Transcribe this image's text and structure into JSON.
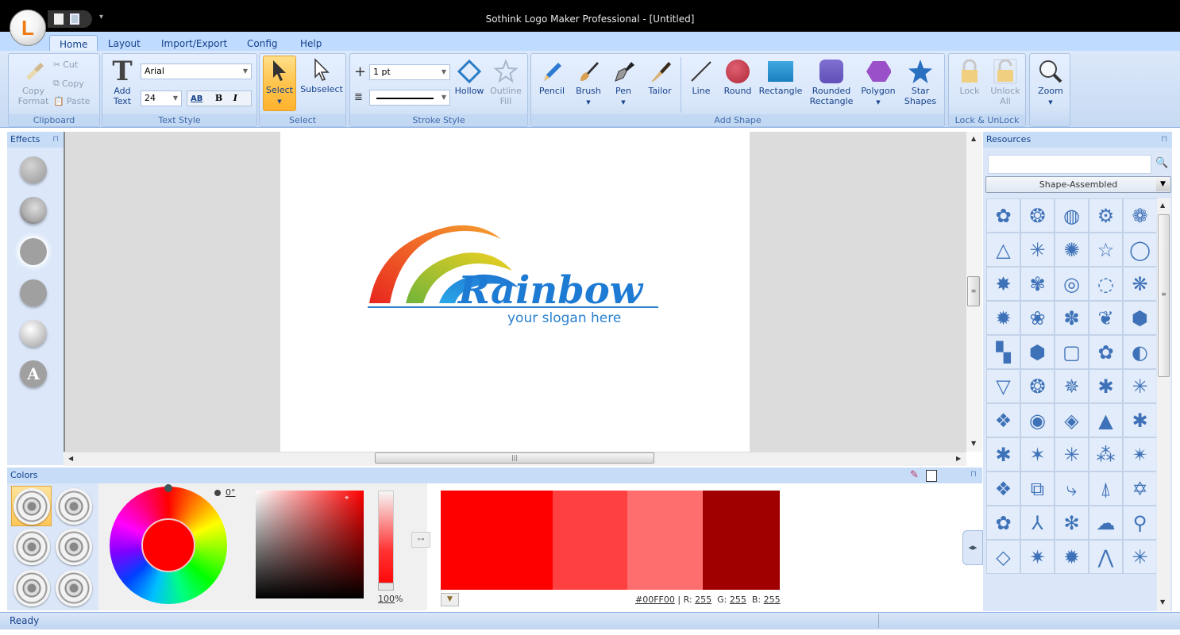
{
  "window": {
    "title": "Sothink Logo Maker Professional - [Untitled]",
    "orb_letter": "L"
  },
  "tabs": [
    {
      "label": "Home",
      "active": true
    },
    {
      "label": "Layout"
    },
    {
      "label": "Import/Export"
    },
    {
      "label": "Config"
    },
    {
      "label": "Help"
    }
  ],
  "ribbon": {
    "clipboard": {
      "label": "Clipboard",
      "copy_format": "Copy Format",
      "cut": "Cut",
      "copy": "Copy",
      "paste": "Paste"
    },
    "text_style": {
      "label": "Text Style",
      "add_text": "Add Text",
      "font": "Arial",
      "size": "24",
      "bold": "B",
      "italic": "I",
      "spacing": "AB"
    },
    "select": {
      "label": "Select",
      "select": "Select",
      "subselect": "Subselect"
    },
    "stroke_style": {
      "label": "Stroke Style",
      "width": "1 pt",
      "hollow": "Hollow",
      "outline_fill": "Outline Fill"
    },
    "draw": {
      "pencil": "Pencil",
      "brush": "Brush",
      "pen": "Pen",
      "tailor": "Tailor"
    },
    "add_shape": {
      "label": "Add Shape",
      "line": "Line",
      "round": "Round",
      "rectangle": "Rectangle",
      "rounded_rectangle": "Rounded Rectangle",
      "polygon": "Polygon",
      "star_shapes": "Star Shapes"
    },
    "lock": {
      "label": "Lock & UnLock",
      "lock": "Lock",
      "unlock_all": "Unlock All"
    },
    "zoom": {
      "label": "Zoom"
    }
  },
  "effects": {
    "title": "Effects",
    "items": [
      "shadow",
      "bevel",
      "glow",
      "reflection",
      "gradient",
      "text"
    ],
    "text_glyph": "A"
  },
  "canvas": {
    "logo_title": "Rainbow",
    "logo_slogan": "your slogan here",
    "colors": {
      "arc1": "#e8321e",
      "arc2": "#8cc63e",
      "arc3": "#2a9de3",
      "text": "#1e7bd4"
    }
  },
  "resources": {
    "title": "Resources",
    "search_placeholder": "",
    "category": "Shape-Assembled",
    "shapes": [
      "✿",
      "❂",
      "◍",
      "⚙",
      "❁",
      "△",
      "✳",
      "✺",
      "☆",
      "◯",
      "✸",
      "✾",
      "◎",
      "◌",
      "❋",
      "✹",
      "❀",
      "✽",
      "❦",
      "⬢",
      "▚",
      "⬢",
      "▢",
      "✿",
      "◐",
      "▽",
      "❂",
      "✵",
      "✱",
      "✳",
      "❖",
      "◉",
      "◈",
      "▲",
      "✱",
      "✱",
      "✶",
      "✳",
      "⁂",
      "✴",
      "❖",
      "⧉",
      "⤷",
      "⍋",
      "✡",
      "✿",
      "⅄",
      "✻",
      "☁",
      "⚲",
      "◇",
      "✷",
      "✹",
      "⋀",
      "✳"
    ]
  },
  "colors": {
    "title": "Colors",
    "angle": "0°",
    "alpha": "100",
    "alpha_unit": "%",
    "swatches": [
      "#ff0000",
      "#ff4040",
      "#ff6e6e",
      "#a00000"
    ],
    "hex": "#00FF00",
    "r": "255",
    "g": "255",
    "b": "255",
    "r_label": "R:",
    "g_label": "G:",
    "b_label": "B:"
  },
  "status": {
    "text": "Ready"
  }
}
